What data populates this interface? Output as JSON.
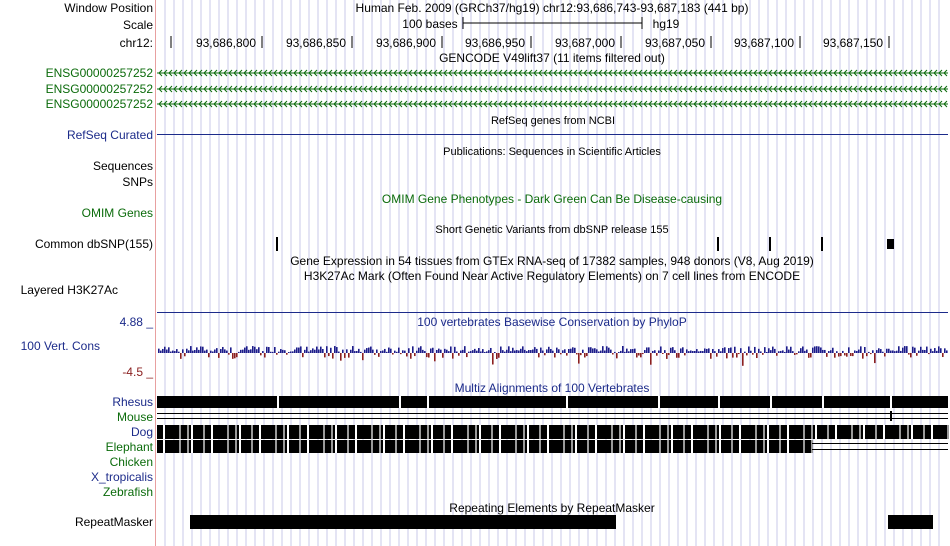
{
  "labels": {
    "window_position": "Window Position",
    "scale": "Scale",
    "chrom": "chr12:",
    "gencode_gene_1": "ENSG00000257252",
    "gencode_gene_2": "ENSG00000257252",
    "gencode_gene_3": "ENSG00000257252",
    "refseq": "RefSeq Curated",
    "sequences": "Sequences",
    "snps": "SNPs",
    "omim": "OMIM Genes",
    "common_dbsnp": "Common dbSNP(155)",
    "layered_h3k27ac": "Layered H3K27Ac",
    "cons_max": "4.88 _",
    "cons_label": "100 Vert. Cons",
    "cons_min": "-4.5 _",
    "species": [
      "Rhesus",
      "Mouse",
      "Dog",
      "Elephant",
      "Chicken",
      "X_tropicalis",
      "Zebrafish"
    ],
    "repeatmasker": "RepeatMasker"
  },
  "titles": {
    "position": "Human Feb. 2009 (GRCh37/hg19)   chr12:93,686,743-93,687,183 (441 bp)",
    "scale_text": "100 bases",
    "assembly": "hg19",
    "gencode": "GENCODE V49lift37 (11 items filtered out)",
    "refseq": "RefSeq genes from NCBI",
    "publications": "Publications: Sequences in Scientific Articles",
    "omim": "OMIM Gene Phenotypes - Dark Green Can Be Disease-causing",
    "dbsnp": "Short Genetic Variants from dbSNP release 155",
    "gtex": "Gene Expression in 54 tissues from GTEx RNA-seq of 17382 samples, 948 donors (V8, Aug 2019)",
    "h3k27ac": "H3K27Ac Mark (Often Found Near Active Regulatory Elements) on 7 cell lines from ENCODE",
    "phylop": "100 vertebrates Basewise Conservation by PhyloP",
    "multiz": "Multiz Alignments of 100 Vertebrates",
    "repeatmasker": "Repeating Elements by RepeatMasker"
  },
  "ruler_ticks": [
    "93,686,800",
    "93,686,850",
    "93,686,900",
    "93,686,950",
    "93,687,000",
    "93,687,050",
    "93,687,100",
    "93,687,150"
  ],
  "colors": {
    "gencode_green": "#0b6b0b",
    "track_blue": "#1c2b8a",
    "cons_positive": "#1c1c8a",
    "cons_negative": "#8b2020",
    "grid": "#c8c8ea",
    "margin_line": "#e8a0a0"
  }
}
